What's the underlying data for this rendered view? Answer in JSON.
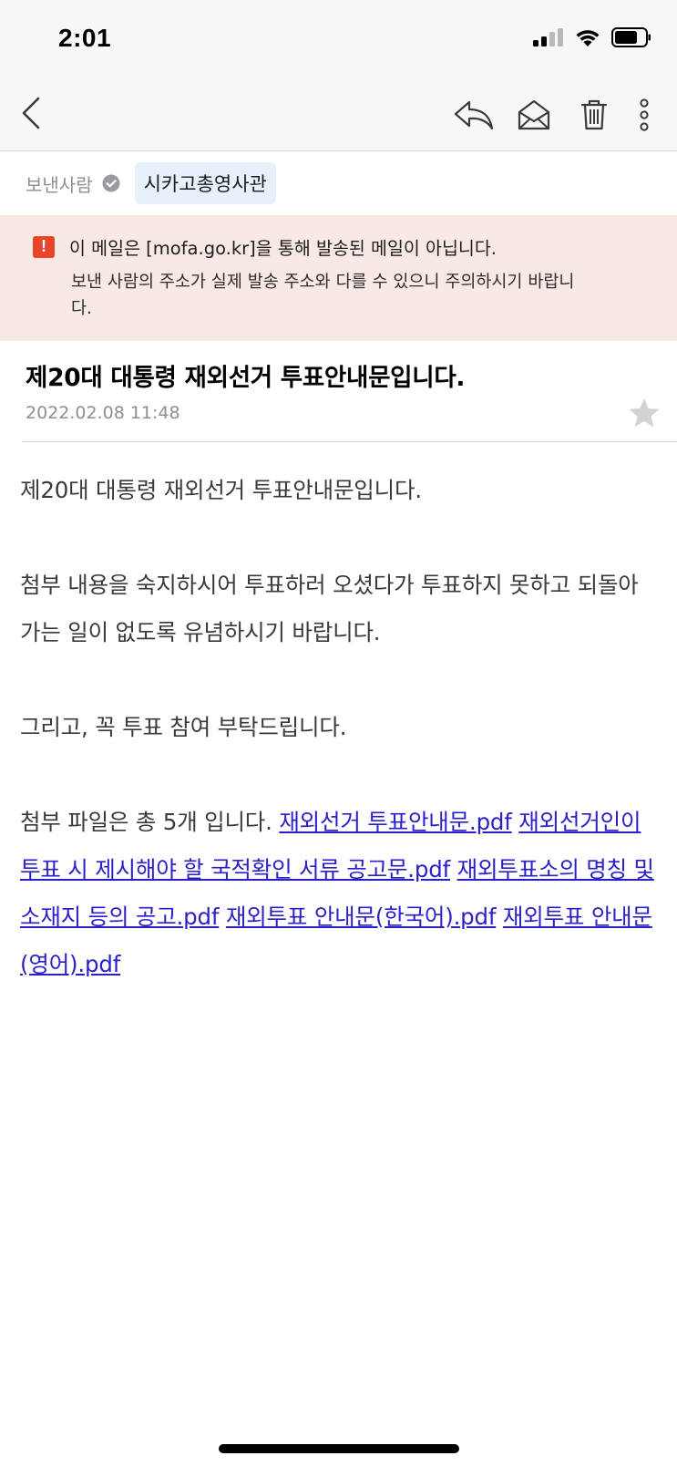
{
  "status_bar": {
    "time": "2:01"
  },
  "nav": {
    "back_icon": "chevron-left-icon",
    "actions": [
      "reply-icon",
      "mark-unread-icon",
      "trash-icon",
      "more-vertical-icon"
    ]
  },
  "sender": {
    "label": "보낸사람",
    "name": "시카고총영사관"
  },
  "warning": {
    "icon": "!",
    "title": "이 메일은 [mofa.go.kr]을 통해 발송된 메일이 아닙니다.",
    "body": "보낸 사람의 주소가 실제 발송 주소와 다를 수 있으니 주의하시기 바랍니다.",
    "accent_color": "#e8452c"
  },
  "message": {
    "subject": "제20대 대통령 재외선거 투표안내문입니다.",
    "date": "2022.02.08 11:48",
    "paragraphs": [
      "제20대 대통령 재외선거 투표안내문입니다.",
      "첨부 내용을 숙지하시어 투표하러 오셨다가 투표하지 못하고 되돌아가는 일이 없도록 유념하시기 바랍니다.",
      "그리고, 꼭 투표 참여 부탁드립니다."
    ],
    "attachments_intro": "첨부 파일은 총 5개 입니다.",
    "attachments": [
      "재외선거 투표안내문.pdf",
      "재외선거인이 투표 시 제시해야 할 국적확인 서류 공고문.pdf",
      "재외투표소의 명칭 및 소재지 등의 공고.pdf",
      "재외투표 안내문(한국어).pdf",
      "재외투표 안내문(영어).pdf"
    ],
    "link_color": "#2a1fc9"
  }
}
